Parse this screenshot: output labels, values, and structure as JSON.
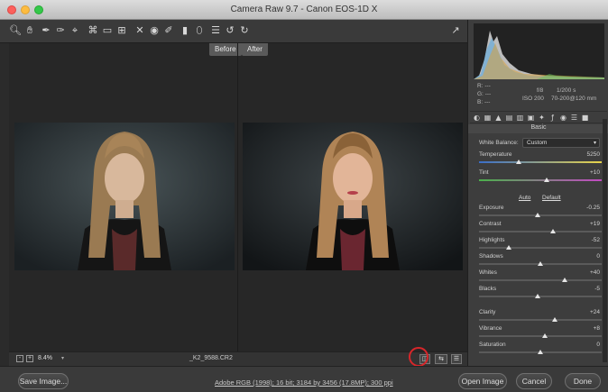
{
  "window": {
    "title": "Camera Raw 9.7  -  Canon EOS-1D X"
  },
  "toolbar": {
    "tools": [
      "zoom-icon",
      "hand-icon",
      "white-balance-icon",
      "color-sampler-icon",
      "targeted-adjustment-icon",
      "crop-icon",
      "straighten-icon",
      "transform-icon",
      "spot-removal-icon",
      "red-eye-icon",
      "adjustment-brush-icon",
      "graduated-filter-icon",
      "radial-filter-icon",
      "preferences-icon",
      "rotate-left-icon",
      "rotate-right-icon",
      "fullscreen-icon"
    ]
  },
  "preview": {
    "before_label": "Before",
    "after_label": "After"
  },
  "status": {
    "zoom": "8.4%",
    "filename": "_K2_9588.CR2"
  },
  "histogram": {
    "r_label": "R:",
    "r_value": "---",
    "g_label": "G:",
    "g_value": "---",
    "b_label": "B:",
    "b_value": "---",
    "aperture": "f/8",
    "shutter": "1/200 s",
    "iso": "ISO 200",
    "lens": "70-200@120 mm"
  },
  "panel": {
    "title": "Basic",
    "white_balance_label": "White Balance:",
    "white_balance_value": "Custom",
    "auto_label": "Auto",
    "default_label": "Default",
    "sliders": [
      {
        "label": "Temperature",
        "value": "5250",
        "position": 0.32
      },
      {
        "label": "Tint",
        "value": "+10",
        "position": 0.55
      },
      {
        "label": "Exposure",
        "value": "-0.25",
        "position": 0.48
      },
      {
        "label": "Contrast",
        "value": "+19",
        "position": 0.6
      },
      {
        "label": "Highlights",
        "value": "-52",
        "position": 0.24
      },
      {
        "label": "Shadows",
        "value": "0",
        "position": 0.5
      },
      {
        "label": "Whites",
        "value": "+40",
        "position": 0.7
      },
      {
        "label": "Blacks",
        "value": "-5",
        "position": 0.48
      },
      {
        "label": "Clarity",
        "value": "+24",
        "position": 0.62
      },
      {
        "label": "Vibrance",
        "value": "+8",
        "position": 0.54
      },
      {
        "label": "Saturation",
        "value": "0",
        "position": 0.5
      }
    ]
  },
  "bottom": {
    "save_label": "Save Image...",
    "workflow": "Adobe RGB (1998); 16 bit; 3184 by 3456 (17.8MP); 300 ppi",
    "open_label": "Open Image",
    "cancel_label": "Cancel",
    "done_label": "Done"
  },
  "colors": {
    "accent": "#d8262a",
    "background": "#2b2b2b",
    "panel": "#3d3d3d"
  }
}
